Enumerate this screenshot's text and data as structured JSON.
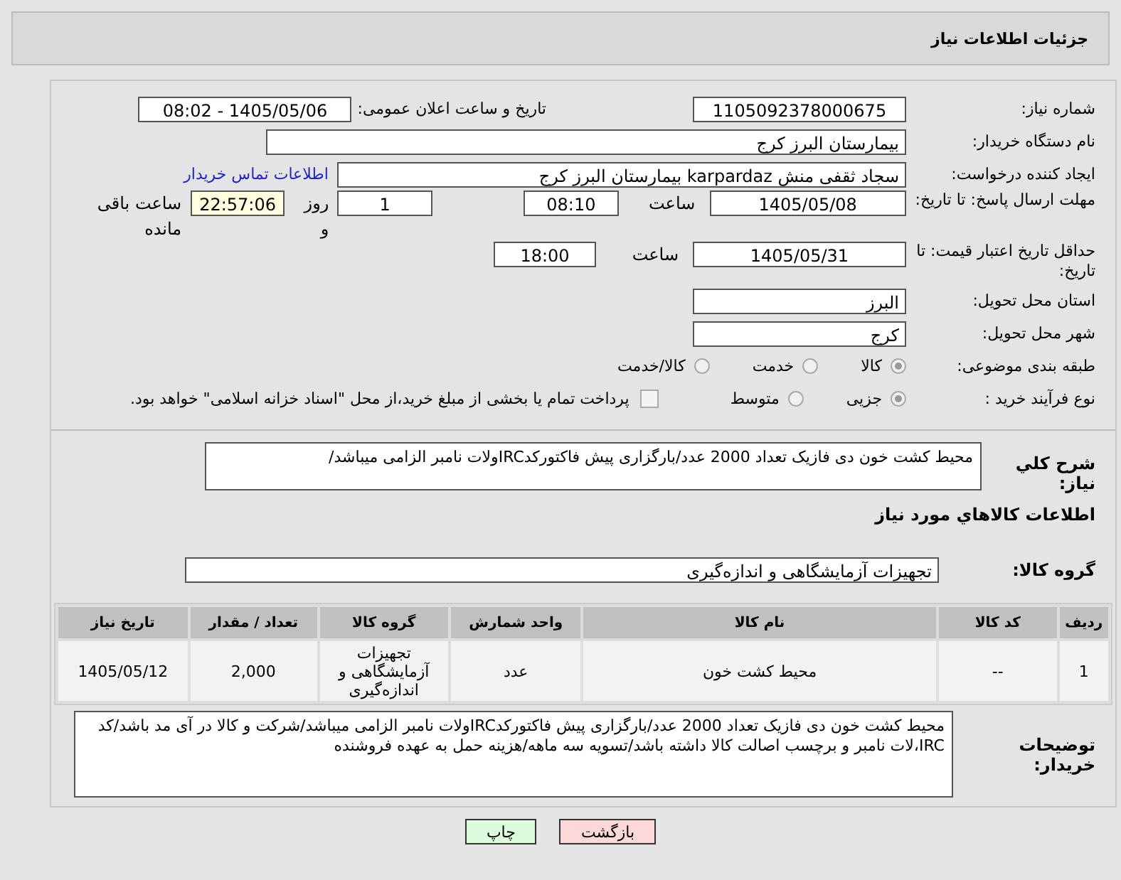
{
  "header": {
    "title": "جزئیات اطلاعات نیاز"
  },
  "need_number": {
    "label": "شماره نیاز:",
    "value": "1105092378000675"
  },
  "announce": {
    "label": "تاریخ و ساعت اعلان عمومی:",
    "value": "1405/05/06 - 08:02"
  },
  "buyer_org": {
    "label": "نام دستگاه خریدار:",
    "value": "بیمارستان البرز کرج"
  },
  "requester": {
    "label": "ایجاد کننده درخواست:",
    "value": "سجاد ثقفی منش karpardaz بیمارستان البرز کرج",
    "link": "اطلاعات تماس خریدار"
  },
  "deadline": {
    "label": "مهلت ارسال پاسخ: تا تاریخ:",
    "date": "1405/05/08",
    "time_label": "ساعت",
    "time": "08:10",
    "days": "1",
    "days_label": "روز و",
    "remaining": "22:57:06",
    "remaining_label": "ساعت باقی مانده"
  },
  "validity": {
    "label": "حداقل تاریخ اعتبار قیمت: تا تاریخ:",
    "date": "1405/05/31",
    "time_label": "ساعت",
    "time": "18:00"
  },
  "province": {
    "label": "استان محل تحویل:",
    "value": "البرز"
  },
  "city": {
    "label": "شهر محل تحویل:",
    "value": "کرج"
  },
  "category": {
    "label": "طبقه بندی موضوعی:",
    "options": [
      {
        "label": "کالا",
        "selected": true
      },
      {
        "label": "خدمت",
        "selected": false
      },
      {
        "label": "کالا/خدمت",
        "selected": false
      }
    ]
  },
  "process": {
    "label": "نوع فرآیند خرید :",
    "options": [
      {
        "label": "جزیی",
        "selected": true
      },
      {
        "label": "متوسط",
        "selected": false
      }
    ],
    "checkbox": {
      "label": "پرداخت تمام یا بخشی از مبلغ خرید،از محل \"اسناد خزانه اسلامی\" خواهد بود.",
      "checked": false
    }
  },
  "description": {
    "label": "شرح کلي نياز:",
    "value": "محیط کشت خون دی فازیک تعداد 2000 عدد/بارگزاری پیش فاکتورکدIRCولات نامبر الزامی میباشد/"
  },
  "goods_title": "اطلاعات کالاهاي مورد نياز",
  "goods_group": {
    "label": "گروه کالا:",
    "value": "تجهیزات آزمایشگاهی و اندازه‌گیری"
  },
  "table": {
    "columns": [
      "ردیف",
      "کد کالا",
      "نام کالا",
      "واحد شمارش",
      "گروه کالا",
      "تعداد / مقدار",
      "تاریخ نیاز"
    ],
    "rows": [
      [
        "1",
        "--",
        "محیط کشت خون",
        "عدد",
        "تجهیزات آزمایشگاهی و اندازه‌گیری",
        "2,000",
        "1405/05/12"
      ]
    ]
  },
  "buyer_notes": {
    "label": "توضیحات خریدار:",
    "value": "محیط کشت خون دی فازیک تعداد 2000 عدد/بارگزاری پیش فاکتورکدIRCولات نامبر الزامی میباشد/شرکت و کالا در آی مد باشد/کد IRC،لات نامبر و برچسب اصالت کالا داشته باشد/تسویه سه ماهه/هزینه حمل به عهده فروشنده"
  },
  "buttons": [
    {
      "label": "بازگشت",
      "kind": "back"
    },
    {
      "label": "چاپ",
      "kind": "print"
    }
  ]
}
